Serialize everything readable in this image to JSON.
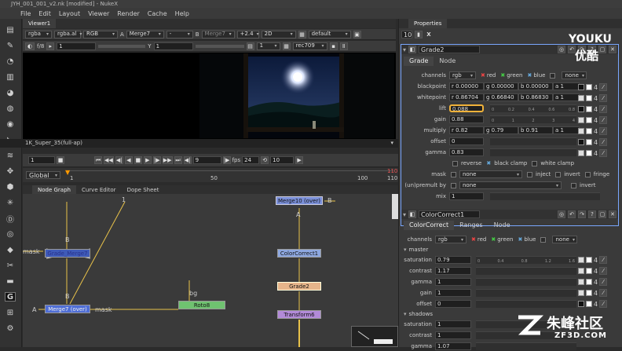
{
  "window": {
    "title": "JYH_001_001_v2.nk [modified] - NukeX"
  },
  "menu": [
    "File",
    "Edit",
    "Layout",
    "Viewer",
    "Render",
    "Cache",
    "Help"
  ],
  "viewer": {
    "tab": "Viewer1",
    "row1": {
      "channels": "rgba",
      "alpha": "rgba.al",
      "display": "RGB",
      "a_label": "A",
      "a_input": "Merge7",
      "dash": "-",
      "b_label": "B",
      "b_input": "Merge7",
      "gain": "+2.4",
      "mode": "2D",
      "lut": "default"
    },
    "row2": {
      "fstop": "f/8",
      "exposure": "1",
      "y_label": "Y",
      "y_value": "1",
      "proxy": "1",
      "colorspace": "rec709"
    },
    "format": "1K_Super_35(full-ap)",
    "playback": {
      "frame": "1",
      "step": "9",
      "fps_label": "fps",
      "fps": "24",
      "increment": "10"
    },
    "timeline": {
      "range": "Global",
      "ticks": [
        "1",
        "50",
        "100"
      ],
      "end": "110",
      "end2": "110"
    }
  },
  "nodegraph": {
    "tabs": [
      "Node Graph",
      "Curve Editor",
      "Dope Sheet"
    ],
    "nodes": {
      "merge10": "Merge10 (over)",
      "cc1": "ColorCorrect1",
      "grade2": "Grade2",
      "transform6": "Transform6",
      "roto8": "Roto8",
      "merge7": "Merge7 (over)",
      "crossed": "Grade_Merge7"
    },
    "labels": {
      "a": "A",
      "b": "B",
      "mask": "mask",
      "bg": "bg",
      "one": "1"
    }
  },
  "properties": {
    "title": "Properties",
    "count": "10",
    "grade": {
      "name": "Grade2",
      "tabs": [
        "Grade",
        "Node"
      ],
      "channels": "rgb",
      "ch_red": "red",
      "ch_green": "green",
      "ch_blue": "blue",
      "ch_none": "none",
      "blackpoint": {
        "label": "blackpoint",
        "r": "r 0.00000",
        "g": "g 0.00000",
        "b": "b 0.00000",
        "a": "a 1"
      },
      "whitepoint": {
        "label": "whitepoint",
        "r": "r 0.86704",
        "g": "g 0.66840",
        "b": "b 0.86830",
        "a": "a 1"
      },
      "lift": {
        "label": "lift",
        "v": "0.088"
      },
      "gain": {
        "label": "gain",
        "v": "0.88"
      },
      "multiply": {
        "label": "multiply",
        "r": "r 0.82",
        "g": "g 0.79",
        "b": "b 0.91",
        "a": "a 1"
      },
      "offset": {
        "label": "offset",
        "v": "0"
      },
      "gamma": {
        "label": "gamma",
        "v": "0.83"
      },
      "opts": {
        "reverse": "reverse",
        "black": "black clamp",
        "white": "white clamp"
      },
      "mask": {
        "label": "mask",
        "v": "none",
        "inject": "inject",
        "invert": "invert",
        "fringe": "fringe"
      },
      "unpremult": {
        "label": "(un)premult by",
        "v": "none",
        "invert": "invert"
      },
      "mix": {
        "label": "mix",
        "v": "1"
      },
      "ticks": [
        "0",
        "0.1",
        "0.2",
        "0.3",
        "0.4",
        "0.5",
        "0.6",
        "0.7",
        "0.8",
        "0.9"
      ],
      "ticks2": [
        "0",
        "1",
        "2",
        "3",
        "4"
      ]
    },
    "cc": {
      "name": "ColorCorrect1",
      "tabs": [
        "ColorCorrect",
        "Ranges",
        "Node"
      ],
      "channels": "rgb",
      "ch_red": "red",
      "ch_green": "green",
      "ch_blue": "blue",
      "ch_none": "none",
      "section_master": "master",
      "section_shadows": "shadows",
      "saturation": {
        "label": "saturation",
        "v": "0.79"
      },
      "contrast": {
        "label": "contrast",
        "v": "1.17"
      },
      "gamma": {
        "label": "gamma",
        "v": "1"
      },
      "gain": {
        "label": "gain",
        "v": "1"
      },
      "offset": {
        "label": "offset",
        "v": "0"
      },
      "s_saturation": {
        "label": "saturation",
        "v": "1"
      },
      "s_contrast": {
        "label": "contrast",
        "v": "1"
      },
      "s_gamma": {
        "label": "gamma",
        "v": "1.07"
      },
      "ticks": [
        "0",
        "0.2",
        "0.4",
        "0.6",
        "0.8",
        "1",
        "1.2",
        "1.4",
        "1.6",
        "1.8"
      ]
    },
    "badge": "4"
  },
  "watermark": {
    "top": "YOUKU",
    "top2": "优酷",
    "bottom": "朱峰社区",
    "bottom2": "ZF3D.COM"
  }
}
